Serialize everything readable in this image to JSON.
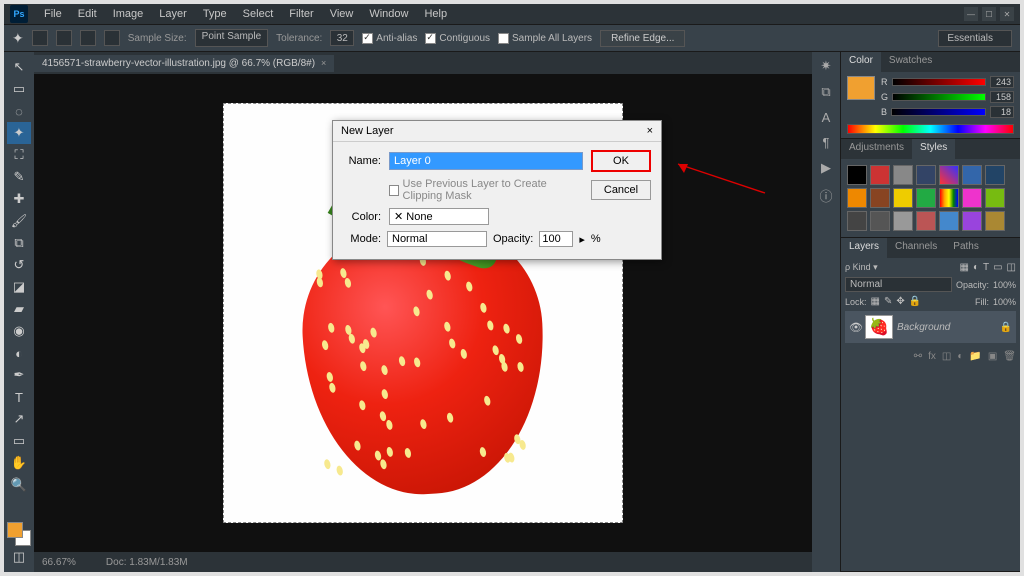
{
  "menu": {
    "items": [
      "File",
      "Edit",
      "Image",
      "Layer",
      "Type",
      "Select",
      "Filter",
      "View",
      "Window",
      "Help"
    ]
  },
  "options_bar": {
    "sample_size_label": "Sample Size:",
    "sample_size_value": "Point Sample",
    "tolerance_label": "Tolerance:",
    "tolerance_value": "32",
    "antialias_label": "Anti-alias",
    "contiguous_label": "Contiguous",
    "sample_all_label": "Sample All Layers",
    "refine_label": "Refine Edge...",
    "workspace": "Essentials"
  },
  "doc_tab": {
    "title": "4156571-strawberry-vector-illustration.jpg @ 66.7% (RGB/8#)",
    "close": "×"
  },
  "status": {
    "zoom": "66.67%",
    "doc_label": "Doc:",
    "doc_size": "1.83M/1.83M"
  },
  "panels": {
    "color_tab": "Color",
    "swatches_tab": "Swatches",
    "adjustments_tab": "Adjustments",
    "styles_tab": "Styles",
    "layers_tab": "Layers",
    "channels_tab": "Channels",
    "paths_tab": "Paths",
    "rgb": {
      "r_label": "R",
      "r": "243",
      "g_label": "G",
      "g": "158",
      "b_label": "B",
      "b": "18"
    },
    "layer_kind": "Kind",
    "normal": "Normal",
    "opacity_label": "Opacity:",
    "opacity": "100%",
    "lock_label": "Lock:",
    "fill_label": "Fill:",
    "fill": "100%",
    "bg_layer": "Background"
  },
  "dialog": {
    "title": "New Layer",
    "close": "×",
    "name_label": "Name:",
    "name_value": "Layer 0",
    "clip_label": "Use Previous Layer to Create Clipping Mask",
    "color_label": "Color:",
    "color_value": "None",
    "color_prefix": "✕",
    "mode_label": "Mode:",
    "mode_value": "Normal",
    "opacity_label": "Opacity:",
    "opacity_value": "100",
    "pct": "%",
    "ok": "OK",
    "cancel": "Cancel"
  },
  "chart_data": {
    "type": "none"
  }
}
